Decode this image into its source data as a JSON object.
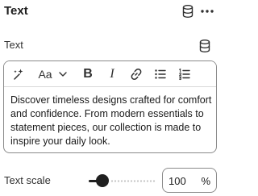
{
  "panel": {
    "title": "Text"
  },
  "text_field": {
    "label": "Text",
    "toolbar": {
      "font_style_label": "Aa",
      "bold_label": "B",
      "italic_label": "I"
    },
    "content": "Discover timeless designs crafted for comfort and confidence. From modern essentials to statement pieces, our collection is made to inspire your daily look."
  },
  "text_scale": {
    "label": "Text scale",
    "value": "100",
    "unit": "%",
    "slider_fraction": 0.2
  },
  "icons": {
    "header": [
      "database-icon",
      "more-icon"
    ],
    "field": [
      "database-icon"
    ],
    "toolbar": [
      "magic-sparkle-icon",
      "font-style-icon",
      "chevron-down-icon",
      "bold-icon",
      "italic-icon",
      "link-icon",
      "bullet-list-icon",
      "numbered-list-icon"
    ]
  },
  "colors": {
    "text": "#303030",
    "slider_active": "#1f1f1f",
    "border": "#8a8a8a"
  }
}
